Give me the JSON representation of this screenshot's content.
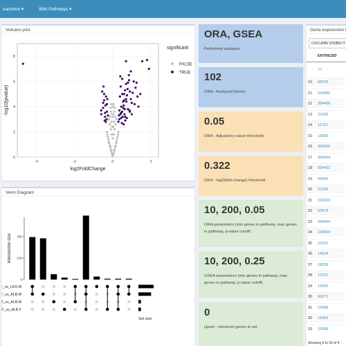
{
  "nav": {
    "item1": "eactome ▾",
    "item2": "Wiki Pathways ▾"
  },
  "volcano": {
    "title": "Volcano plot",
    "legend_title": "significant",
    "legend_false": "FALSE",
    "legend_true": "TRUE",
    "color_false": "#bdbdbd",
    "color_true": "#3b0f5e"
  },
  "venn": {
    "title": "Venn Diagram"
  },
  "stats": [
    {
      "value": "ORA, GSEA",
      "label": "Performed analyses"
    },
    {
      "value": "102",
      "label": "ORA - Analysed Genes"
    },
    {
      "value": "0.05",
      "label": "ORA - Adjusted p-value threshold"
    },
    {
      "value": "0.322",
      "label": "ORA - log2(fold-change) threshold"
    },
    {
      "value": "10, 200, 0.05",
      "label": "ORA parameters (min genes in pathway, max genes in pathway, p-value cutoff)"
    },
    {
      "value": "10, 200, 0.25",
      "label": "GSEA parameters (min genes in pathway, max genes in pathway, p-value cutoff)"
    },
    {
      "value": "0",
      "label": "Upset - minimum genes in set"
    }
  ],
  "table": {
    "title": "Gene expression tabl",
    "col_vis_button": "COLUMN VISIBILIT",
    "header": "ENTREZID",
    "filter_placeholder": "All",
    "rows": [
      [
        "10",
        "68375"
      ],
      [
        "11",
        "243085"
      ],
      [
        "12",
        "394436"
      ],
      [
        "13",
        "22235"
      ],
      [
        "14",
        "11761"
      ],
      [
        "15",
        "13095"
      ],
      [
        "16",
        "394435"
      ],
      [
        "17",
        "394434"
      ],
      [
        "18",
        "394432"
      ],
      [
        "19",
        "94284"
      ],
      [
        "20",
        "22236"
      ],
      [
        "21",
        "223920"
      ],
      [
        "22",
        "53978"
      ],
      [
        "23",
        "394430"
      ],
      [
        "24",
        "234564"
      ],
      [
        "25",
        "16151"
      ],
      [
        "26",
        "14629"
      ],
      [
        "27",
        "18639"
      ],
      [
        "28",
        "13112"
      ],
      [
        "29",
        "14630"
      ],
      [
        "30",
        "66071"
      ],
      [
        "31",
        "19368"
      ],
      [
        "32",
        "19369"
      ],
      [
        "33",
        "19368"
      ]
    ],
    "footer": "Showing 9 to 33 of 4"
  },
  "chart_data": [
    {
      "type": "scatter",
      "title": "",
      "xlabel": "log2FoldChange",
      "ylabel": "-log10(pvalue)",
      "xlim": [
        -5,
        2.4
      ],
      "ylim": [
        0,
        9
      ],
      "xticks": [
        -4,
        -2,
        0,
        2
      ],
      "yticks": [
        0,
        2,
        4,
        6,
        8
      ],
      "legend_placement": "right",
      "series": [
        {
          "name": "FALSE",
          "color": "#bdbdbd",
          "x": [
            0.0,
            0.05,
            -0.05,
            0.1,
            -0.1,
            0.15,
            -0.15,
            0.2,
            -0.2,
            0.25,
            -0.25,
            0.3,
            -0.3,
            0.02,
            -0.02,
            0.08,
            -0.08,
            0.12,
            -0.12,
            0.18,
            -0.18,
            0.22,
            -0.22,
            0.28,
            -0.28,
            0.0,
            0.05,
            -0.05,
            0.1,
            -0.1,
            0.15,
            -0.15,
            0.2,
            -0.2,
            0.03,
            -0.03,
            0.07,
            -0.07,
            0.0,
            0.04,
            -0.04,
            0.09,
            -0.09,
            0.14,
            -0.14,
            0.01,
            0.06,
            -0.06,
            0.11,
            -0.11
          ],
          "y": [
            0.1,
            0.3,
            0.3,
            0.6,
            0.6,
            0.9,
            0.9,
            1.2,
            1.2,
            1.6,
            1.6,
            2.0,
            2.0,
            0.2,
            0.2,
            0.5,
            0.5,
            0.8,
            0.8,
            1.1,
            1.1,
            1.4,
            1.4,
            1.8,
            1.8,
            1.5,
            1.8,
            1.8,
            2.2,
            2.2,
            2.6,
            2.6,
            3.0,
            3.0,
            2.4,
            2.4,
            2.8,
            2.8,
            3.2,
            3.4,
            3.4,
            3.6,
            3.6,
            3.2,
            3.2,
            4.0,
            4.2,
            4.2,
            3.9,
            3.9
          ]
        },
        {
          "name": "TRUE",
          "color": "#3b0f5e",
          "x": [
            -4.7,
            -0.6,
            -0.5,
            -0.45,
            -0.4,
            -0.35,
            -0.3,
            -0.55,
            -0.42,
            -0.38,
            -0.32,
            -0.28,
            -0.5,
            -0.6,
            -0.45,
            -0.4,
            -0.36,
            -0.3,
            -0.25,
            -0.48,
            0.35,
            0.4,
            0.45,
            0.5,
            0.55,
            0.6,
            0.65,
            0.7,
            0.8,
            0.9,
            1.0,
            1.1,
            1.2,
            0.3,
            0.38,
            0.42,
            0.5,
            0.58,
            0.62,
            0.7,
            0.75,
            0.85,
            0.95,
            1.05,
            1.15,
            1.3,
            0.45,
            0.55,
            0.65,
            0.72,
            0.8,
            0.88,
            0.95,
            1.0,
            0.4,
            0.5,
            0.6,
            0.7,
            0.78,
            0.86,
            1.8,
            1.25,
            1.55,
            1.9,
            0.9,
            0.35,
            0.48,
            0.52,
            0.66,
            1.35,
            1.45,
            0.33,
            0.44,
            0.57,
            0.63,
            0.74
          ],
          "y": [
            7.4,
            3.4,
            3.9,
            4.5,
            3.2,
            4.8,
            3.6,
            5.2,
            2.9,
            4.1,
            3.0,
            4.6,
            4.3,
            3.7,
            5.0,
            3.5,
            2.8,
            4.2,
            3.3,
            5.6,
            3.0,
            3.4,
            4.0,
            3.6,
            4.4,
            5.0,
            3.2,
            4.6,
            3.8,
            5.2,
            4.3,
            6.0,
            5.5,
            2.8,
            4.8,
            5.6,
            6.2,
            4.1,
            3.4,
            5.8,
            4.9,
            6.5,
            4.6,
            5.1,
            4.2,
            4.8,
            3.1,
            3.9,
            5.3,
            4.4,
            5.9,
            3.7,
            6.8,
            3.4,
            6.4,
            5.0,
            4.5,
            7.6,
            5.4,
            6.1,
            7.7,
            5.9,
            7.6,
            7.0,
            3.6,
            3.7,
            2.7,
            3.2,
            2.9,
            4.0,
            5.0,
            3.3,
            3.5,
            2.6,
            3.8,
            3.1
          ]
        }
      ]
    },
    {
      "type": "bar",
      "title": "",
      "ylabel": "Intersection size",
      "xlabel": "Set size",
      "yticks": [
        0,
        100,
        200
      ],
      "ylim": [
        0,
        290
      ],
      "categories": [
        "1",
        "2",
        "3",
        "4",
        "5",
        "6",
        "7",
        "8",
        "9",
        "10"
      ],
      "values": [
        198,
        192,
        25,
        9,
        3,
        298,
        14,
        4,
        4,
        4
      ],
      "sets": [
        "LKO.F_vs_LKO.M",
        "ALB.F_vs_ALB.M",
        "LKO.M_vs_ALB.M",
        "LKO.F_vs_ALB.F"
      ],
      "set_sizes": [
        6,
        5,
        1,
        1
      ],
      "matrix": [
        [
          1,
          1,
          0,
          0
        ],
        [
          0,
          1,
          0,
          0
        ],
        [
          0,
          0,
          1,
          0
        ],
        [
          0,
          0,
          0,
          1
        ],
        [
          1,
          0,
          1,
          0
        ],
        [
          1,
          1,
          0,
          1
        ],
        [
          1,
          0,
          0,
          0
        ],
        [
          1,
          0,
          0,
          1
        ],
        [
          1,
          1,
          0,
          1
        ],
        [
          1,
          1,
          0,
          0
        ]
      ]
    }
  ]
}
